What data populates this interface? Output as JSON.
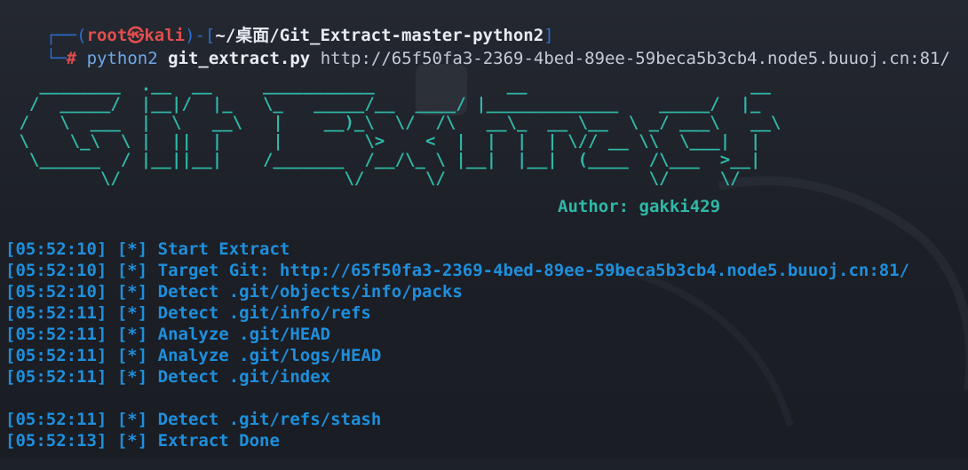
{
  "prompt": {
    "box_open": "┌──(",
    "user": "root",
    "at": "㉿",
    "host": "kali",
    "box_mid": ")-[",
    "path": "~/桌面/Git_Extract-master-python2",
    "box_close": "]",
    "box_bottom": "└─",
    "hash": "#",
    "command": "python2",
    "script": "git_extract.py",
    "url": "http://65f50fa3-2369-4bed-89ee-59beca5b3cb4.node5.buuoj.cn:81/"
  },
  "banner": {
    "ascii": "   ________  .__  __     ___________             __                      __   \n  /  _____/  |__|/  |_   \\_   _____/__  ____/ |_____________    _____/  |_ \n /   \\  ___  |  \\   __\\   |    __)_\\  \\/  /\\   __\\_  __ \\__  \\ _/ ___\\   __\\\n \\    \\_\\  \\ |  ||  |     |        \\>    <  |  |  |  | \\// __ \\\\  \\___|  |  \n  \\______  / |__||__|    /_______  /__/\\_ \\ |__|  |__|  (____  /\\___  >__|  \n         \\/                      \\/      \\/                    \\/     \\/      ",
    "author": "Author: gakki429"
  },
  "log": [
    {
      "time": "[05:52:10]",
      "tag": "[*]",
      "msg": "Start Extract"
    },
    {
      "time": "[05:52:10]",
      "tag": "[*]",
      "msg": "Target Git: http://65f50fa3-2369-4bed-89ee-59beca5b3cb4.node5.buuoj.cn:81/"
    },
    {
      "time": "[05:52:10]",
      "tag": "[*]",
      "msg": "Detect .git/objects/info/packs"
    },
    {
      "time": "[05:52:11]",
      "tag": "[*]",
      "msg": "Detect .git/info/refs"
    },
    {
      "time": "[05:52:11]",
      "tag": "[*]",
      "msg": "Analyze .git/HEAD"
    },
    {
      "time": "[05:52:11]",
      "tag": "[*]",
      "msg": "Analyze .git/logs/HEAD"
    },
    {
      "time": "[05:52:11]",
      "tag": "[*]",
      "msg": "Detect .git/index"
    },
    {
      "time": "[05:52:11]",
      "tag": "[*]",
      "msg": "Detect .git/refs/stash"
    },
    {
      "time": "[05:52:13]",
      "tag": "[*]",
      "msg": "Extract Done"
    }
  ],
  "colors": {
    "background": "#1d2129",
    "prompt_box": "#2a6fd1",
    "prompt_user": "#e04e4e",
    "banner": "#2fb8a8",
    "log": "#1e8fdc"
  }
}
